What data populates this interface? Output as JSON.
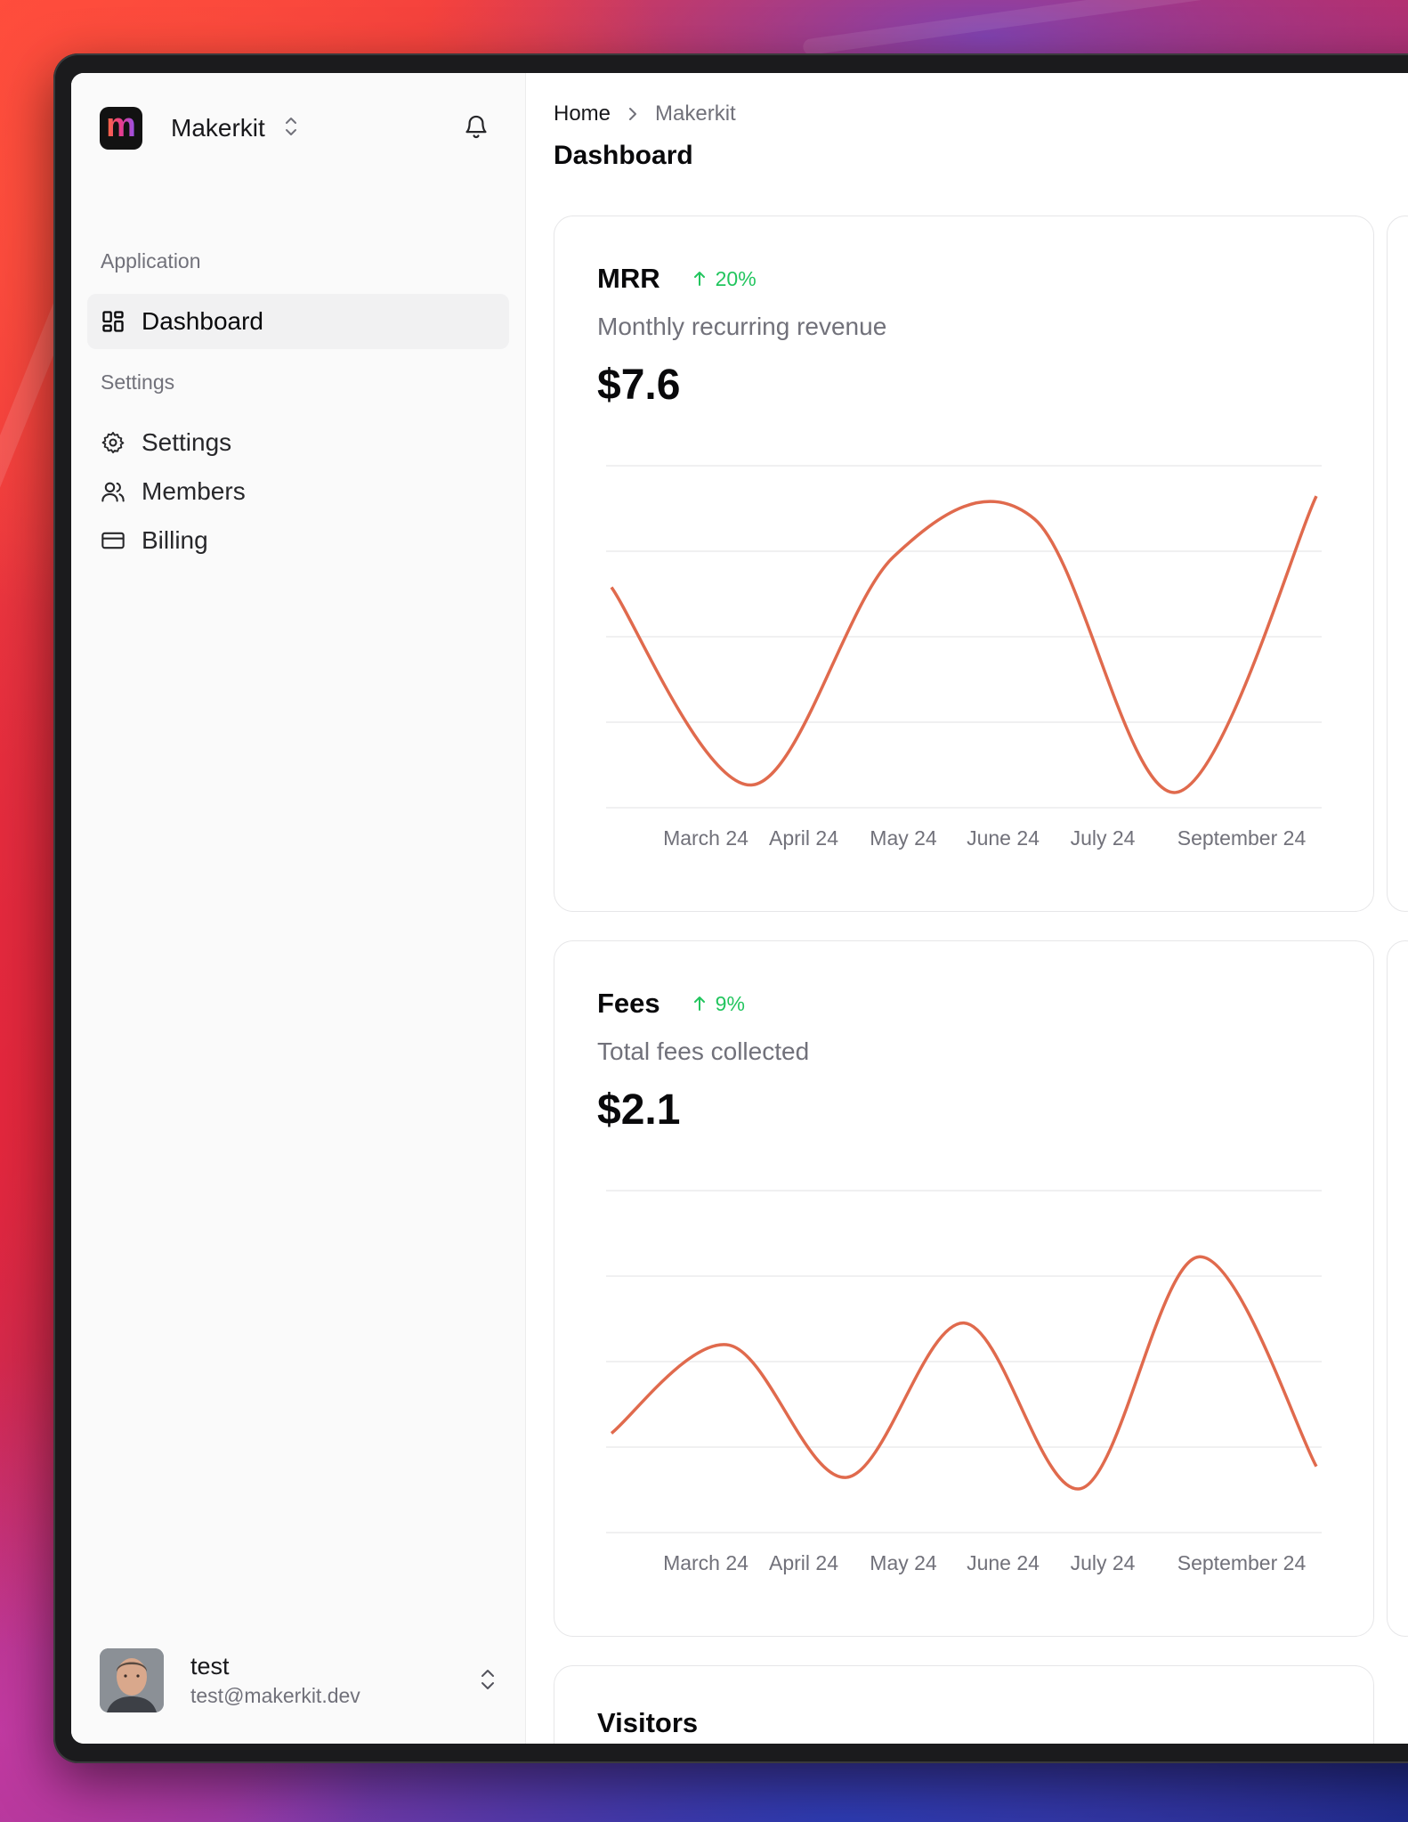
{
  "app": {
    "name": "Makerkit",
    "logo_letter": "m"
  },
  "sidebar": {
    "sections": [
      {
        "label": "Application",
        "items": [
          {
            "label": "Dashboard",
            "icon": "dashboard-grid-icon",
            "active": true
          }
        ]
      },
      {
        "label": "Settings",
        "items": [
          {
            "label": "Settings",
            "icon": "gear-icon"
          },
          {
            "label": "Members",
            "icon": "users-icon"
          },
          {
            "label": "Billing",
            "icon": "credit-card-icon"
          }
        ]
      }
    ],
    "user": {
      "name": "test",
      "email": "test@makerkit.dev"
    }
  },
  "header": {
    "breadcrumb": [
      "Home",
      "Makerkit"
    ],
    "title": "Dashboard"
  },
  "cards": [
    {
      "title": "MRR",
      "trend": "20%",
      "subtitle": "Monthly recurring revenue",
      "value": "$7.6",
      "chart_data": {
        "type": "line",
        "categories": [
          "March 24",
          "April 24",
          "May 24",
          "June 24",
          "July 24",
          "September 24"
        ],
        "values": [
          6.4,
          3.8,
          6.8,
          7.3,
          3.7,
          7.6
        ],
        "ylim": [
          3.5,
          8.0
        ],
        "grid": true,
        "color": "#e06a4d"
      }
    },
    {
      "title": "Fees",
      "trend": "9%",
      "subtitle": "Total fees collected",
      "value": "$2.1",
      "chart_data": {
        "type": "line",
        "categories": [
          "March 24",
          "April 24",
          "May 24",
          "June 24",
          "July 24",
          "September 24"
        ],
        "values": [
          1.5,
          2.3,
          1.1,
          2.5,
          1.0,
          3.1,
          1.2
        ],
        "ylim": [
          0.6,
          3.7
        ],
        "grid": true,
        "color": "#e06a4d"
      }
    },
    {
      "title": "Visitors"
    }
  ],
  "colors": {
    "accent": "#e06a4d",
    "trend_up": "#22c55e"
  }
}
